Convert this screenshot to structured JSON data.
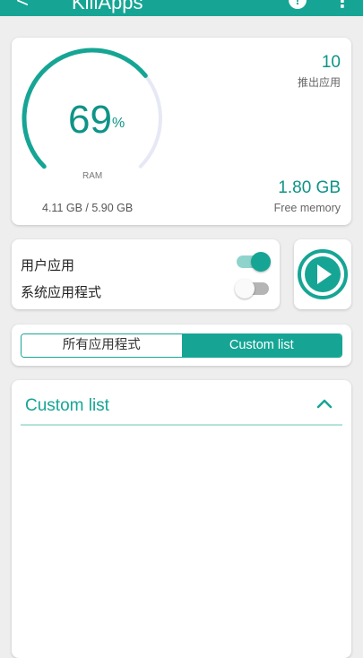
{
  "appbar": {
    "back_icon": "arrow-back-icon",
    "back_glyph": "<",
    "title": "KillApps",
    "info_glyph": "!",
    "more_glyph": "⋮"
  },
  "memory": {
    "percent": "69",
    "percent_sign": "%",
    "percent_fraction": 0.69,
    "ram_label": "RAM",
    "ram_usage": "4.11 GB / 5.90 GB",
    "killed_count": "10",
    "killed_label": "推出应用",
    "free_memory": "1.80 GB",
    "free_label": "Free memory"
  },
  "toggles": {
    "user_apps": {
      "label": "用户应用",
      "on": true
    },
    "system_apps": {
      "label": "系统应用程式",
      "on": false
    }
  },
  "tabs": [
    {
      "label": "所有应用程式",
      "active": false
    },
    {
      "label": "Custom list",
      "active": true
    }
  ],
  "custom_list": {
    "title": "Custom list",
    "expanded": true
  },
  "colors": {
    "accent": "#16a594",
    "accent_text": "#0e9486",
    "gauge_track": "#e6e9f5"
  }
}
